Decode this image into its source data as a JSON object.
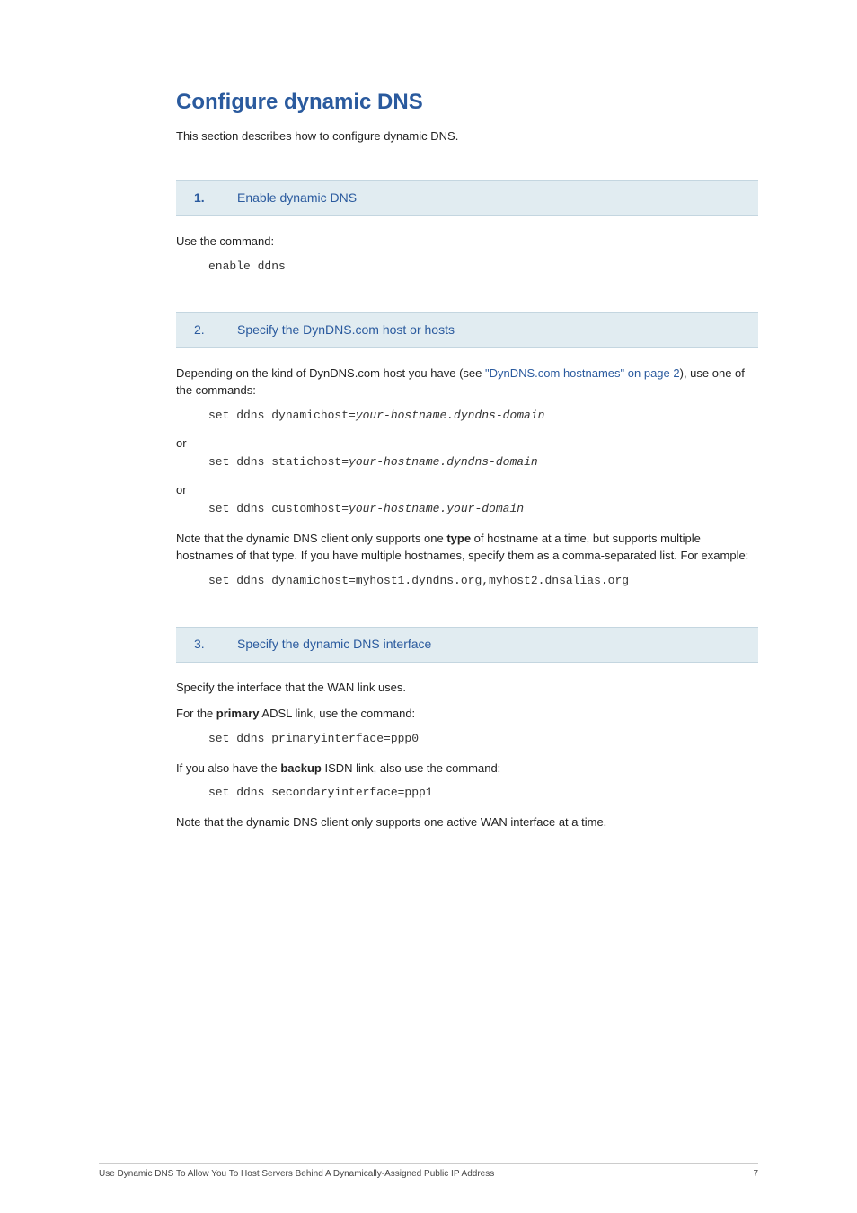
{
  "title": "Configure dynamic DNS",
  "intro": "This section describes how to configure dynamic DNS.",
  "step1": {
    "num": "1.",
    "title": "Enable dynamic DNS",
    "text1": "Use the command:",
    "code1": "enable ddns"
  },
  "step2": {
    "num": "2.",
    "title": "Specify the DynDNS.com host or hosts",
    "text1_a": "Depending on the kind of DynDNS.com host you have (see ",
    "text1_link": "\"DynDNS.com hostnames\" on page 2",
    "text1_b": "), use one of the commands:",
    "code1_a": "set ddns dynamichost=",
    "code1_b": "your-hostname.dyndns-domain",
    "or1": "or",
    "code2_a": "set ddns statichost=",
    "code2_b": "your-hostname.dyndns-domain",
    "or2": "or",
    "code3_a": "set ddns customhost=",
    "code3_b": "your-hostname.your-domain",
    "text2_a": "Note that the dynamic DNS client only supports one ",
    "text2_bold": "type",
    "text2_b": " of hostname at a time, but supports multiple hostnames of that type. If you have multiple hostnames, specify them as a comma-separated list. For example:",
    "code4": "set ddns dynamichost=myhost1.dyndns.org,myhost2.dnsalias.org"
  },
  "step3": {
    "num": "3.",
    "title": "Specify the dynamic DNS interface",
    "text1": "Specify the interface that the WAN link uses.",
    "text2_a": "For the ",
    "text2_bold": "primary",
    "text2_b": " ADSL link, use the command:",
    "code1": "set ddns primaryinterface=ppp0",
    "text3_a": "If you also have the ",
    "text3_bold": "backup",
    "text3_b": " ISDN link, also use the command:",
    "code2": "set ddns secondaryinterface=ppp1",
    "text4": "Note that the dynamic DNS client only supports one active WAN interface at a time."
  },
  "footer": {
    "left": "Use Dynamic DNS To Allow You To Host Servers Behind A Dynamically-Assigned Public IP Address",
    "right": "7"
  }
}
